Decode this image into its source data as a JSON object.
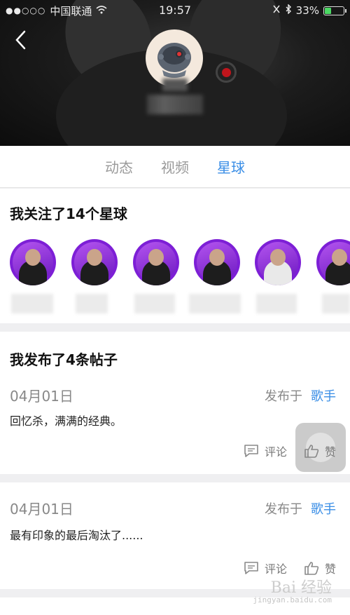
{
  "status_bar": {
    "carrier": "中国联通",
    "time": "19:57",
    "battery_percent": "33%",
    "battery_level": 0.33
  },
  "tabs": [
    {
      "label": "动态",
      "active": false
    },
    {
      "label": "视频",
      "active": false
    },
    {
      "label": "星球",
      "active": true
    }
  ],
  "planets": {
    "title": "我关注了14个星球",
    "count_visible": 6
  },
  "posts_section": {
    "title": "我发布了4条帖子"
  },
  "posts": [
    {
      "date": "04月01日",
      "published_in_label": "发布于",
      "category": "歌手",
      "text": "回忆杀，满满的经典。",
      "comment_label": "评论",
      "like_label": "赞"
    },
    {
      "date": "04月01日",
      "published_in_label": "发布于",
      "category": "歌手",
      "text": "最有印象的最后淘汰了......",
      "comment_label": "评论",
      "like_label": "赞"
    }
  ],
  "colors": {
    "accent": "#3a8ee6",
    "planet_purple": "#7d1fd6",
    "battery_green": "#4cd964"
  },
  "watermark": {
    "text": "Bai 经验",
    "sub": "jingyan.baidu.com"
  }
}
